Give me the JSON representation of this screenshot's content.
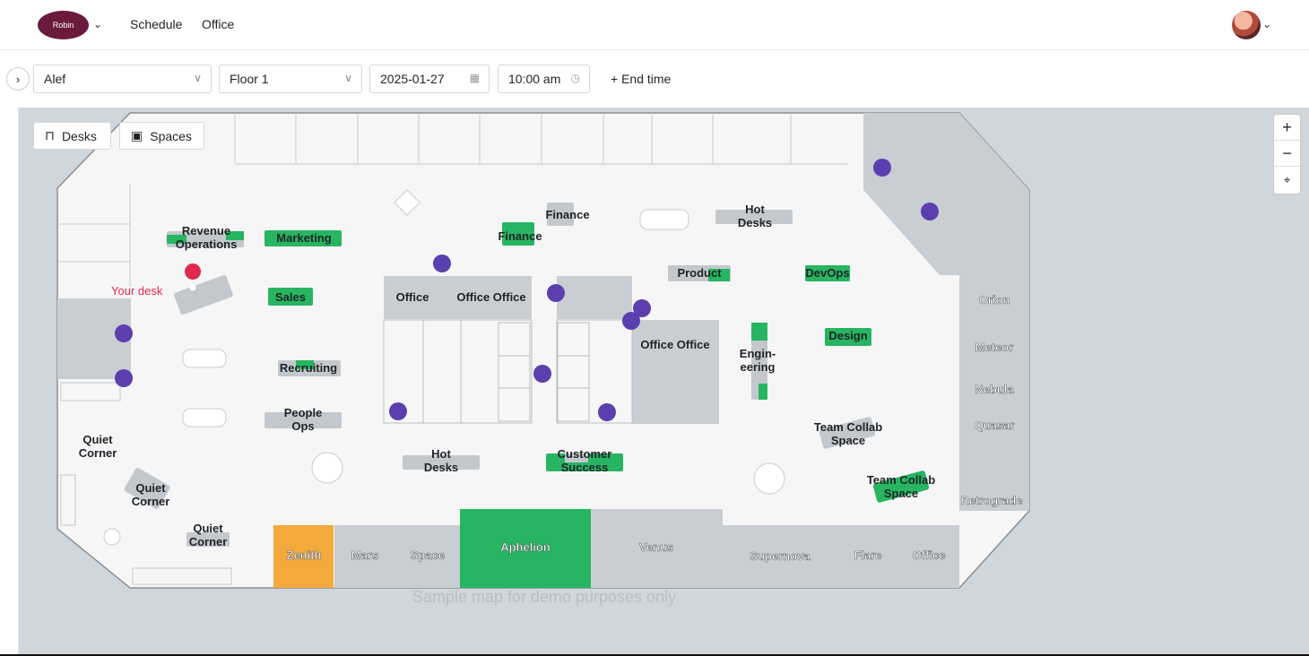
{
  "header": {
    "logo_text": "Robin",
    "nav": [
      "Schedule",
      "Office"
    ]
  },
  "filters": {
    "building": "Alef",
    "floor": "Floor 1",
    "date": "2025-01-27",
    "time": "10:00 am",
    "end_time_label": "+ End time"
  },
  "map": {
    "toggles": {
      "desks": "Desks",
      "spaces": "Spaces"
    },
    "zoom": {
      "in": "+",
      "out": "−",
      "reset": "⌖"
    },
    "your_desk_label": "Your desk",
    "footer_note": "Sample map for demo purposes only",
    "colors": {
      "available": "#27b561",
      "booked": "#c3c8cd",
      "reserved_room": "#f3a93c",
      "amenity": "#5b3fae",
      "your_desk_pin": "#e0284e"
    },
    "zones": {
      "revenue_ops": [
        "Revenue",
        "Operations"
      ],
      "marketing": "Marketing",
      "finance_a": "Finance",
      "finance_b": "Finance",
      "hot_desks_top": [
        "Hot",
        "Desks"
      ],
      "product": "Product",
      "devops": "DevOps",
      "sales": "Sales",
      "office_1": "Office",
      "office_2": "Office Office",
      "office_3": "Office Office",
      "engineering": [
        "Engin-",
        "eering"
      ],
      "design": "Design",
      "recruiting": "Recruiting",
      "people_ops": [
        "People",
        "Ops"
      ],
      "quiet_1": [
        "Quiet",
        "Corner"
      ],
      "quiet_2": [
        "Quiet",
        "Corner"
      ],
      "quiet_3": [
        "Quiet",
        "Corner"
      ],
      "hot_desks_bottom": [
        "Hot",
        "Desks"
      ],
      "customer_success": [
        "Customer",
        "Success"
      ],
      "team_collab_1": [
        "Team Collab",
        "Space"
      ],
      "team_collab_2": [
        "Team Collab",
        "Space"
      ]
    },
    "rooms_right": [
      "Orion",
      "Meteor",
      "Nebula",
      "Quasar",
      "Retrograde"
    ],
    "rooms_bottom": [
      "Zenith",
      "Mars",
      "Space",
      "Aphelion",
      "Venus",
      "Supernova",
      "Flare",
      "Office"
    ]
  }
}
